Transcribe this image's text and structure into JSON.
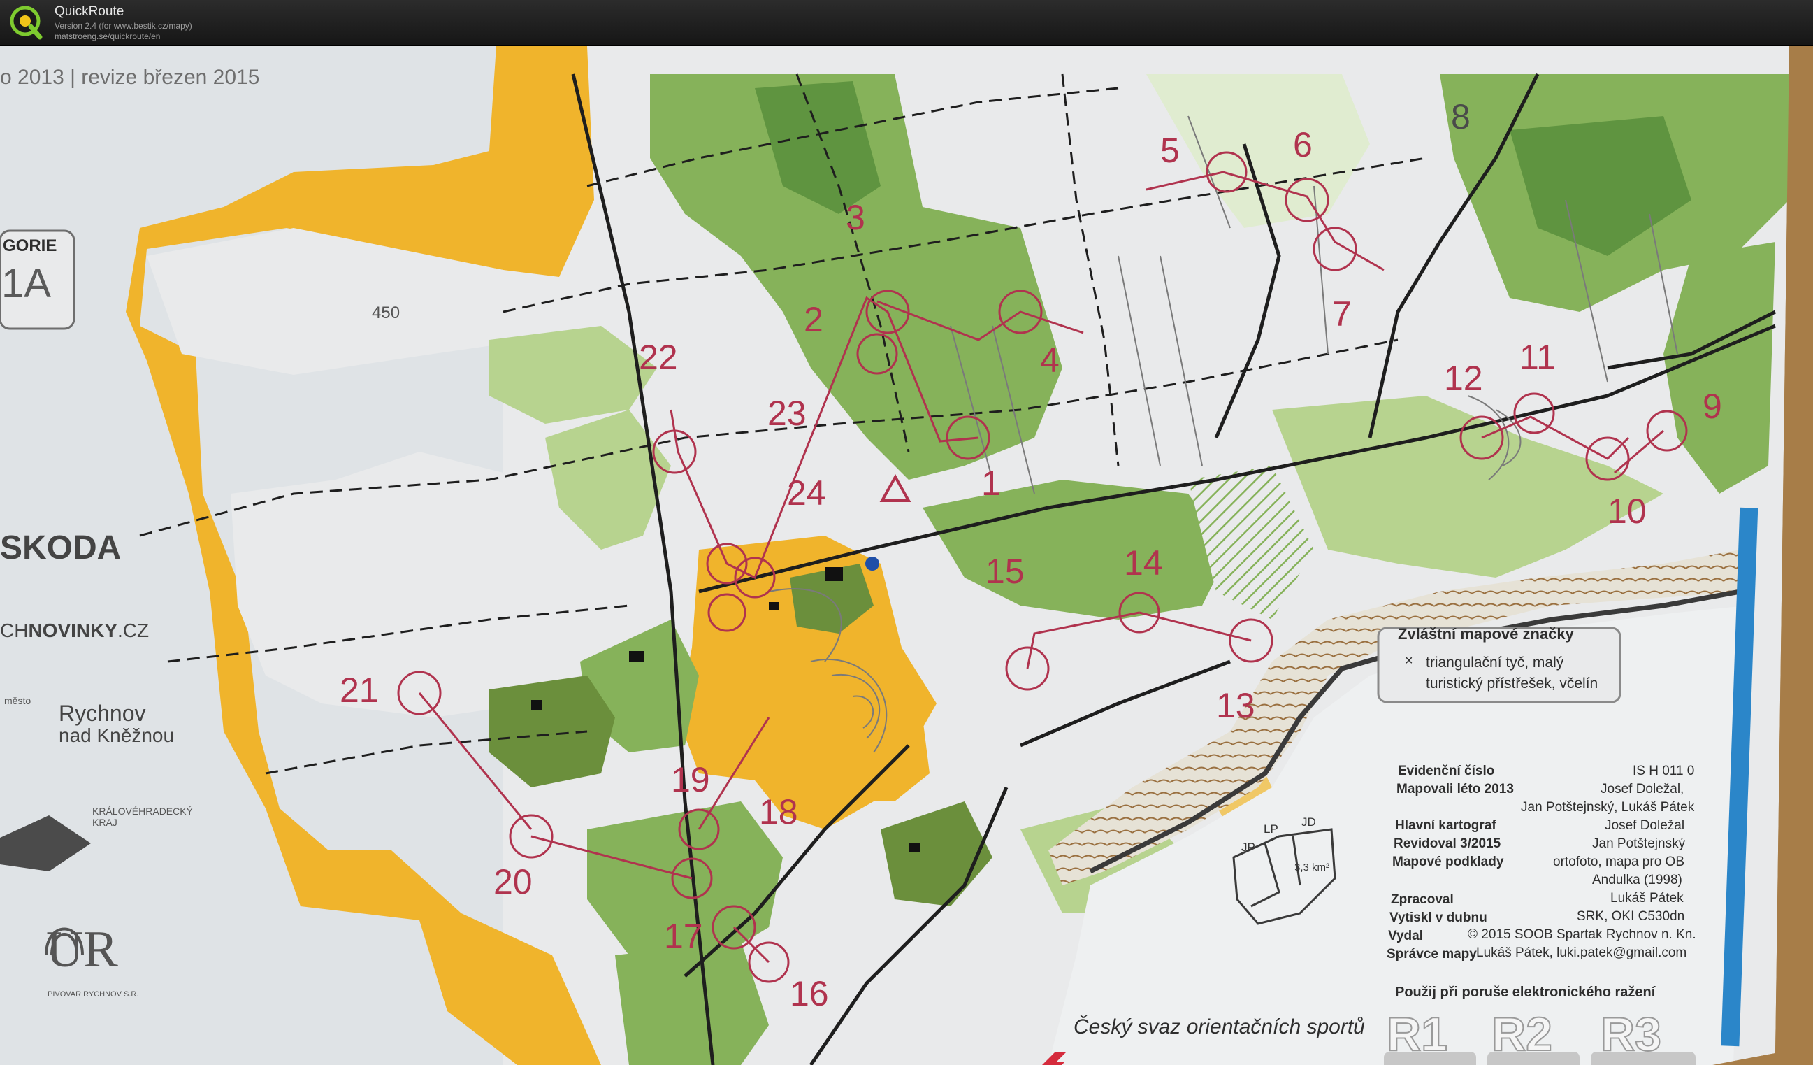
{
  "window": {
    "title": "QuickRoute",
    "version": "Version 2.4  (for www.bestik.cz/mapy)",
    "url": "matstroeng.se/quickroute/en",
    "logo_letter": "Q"
  },
  "map": {
    "header_partial": "o 2013 | revize březen 2015",
    "category_label": "GORIE",
    "category_value": "1A",
    "contour_height": "450",
    "sponsors": {
      "skoda": "SKODA",
      "novinky_prefix": "CH",
      "novinky_bold": "NOVINKY",
      "novinky_suffix": ".CZ",
      "rychnov_line1": "Rychnov",
      "rychnov_line2": "nad Kněžnou",
      "mesto": "město",
      "kraj_line1": "KRÁLOVÉHRADECKÝ",
      "kraj_line2": "KRAJ",
      "brewery_logo": "UR",
      "brewery_name": "PIVOVAR RYCHNOV S.R."
    },
    "controls": [
      "1",
      "2",
      "3",
      "4",
      "5",
      "6",
      "7",
      "8",
      "9",
      "10",
      "11",
      "12",
      "13",
      "14",
      "15",
      "16",
      "17",
      "18",
      "19",
      "20",
      "21",
      "22",
      "23",
      "24"
    ],
    "special_symbols": {
      "title": "Zvláštní mapové značky",
      "symbol": "×",
      "line1": "triangulační tyč, malý",
      "line2": "turistický přístřešek, včelín"
    },
    "map_info": {
      "evidence_label": "Evidenční číslo",
      "evidence_value": "IS H 011 0",
      "mapped_label": "Mapovali léto 2013",
      "mapped_value1": "Josef Doležal,",
      "mapped_value2": "Jan Potštejnský, Lukáš Pátek",
      "cartographer_label": "Hlavní kartograf",
      "cartographer_value": "Josef Doležal",
      "revised_label": "Revidoval 3/2015",
      "revised_value": "Jan Potštejnský",
      "base_label": "Mapové podklady",
      "base_value1": "ortofoto, mapa pro OB",
      "base_value2": "Andulka (1998)",
      "processed_label": "Zpracoval",
      "processed_value": "Lukáš Pátek",
      "printed_label": "Vytiskl v dubnu",
      "printed_value": "SRK, OKI C530dn",
      "published_label": "Vydal",
      "published_value": "© 2015 SOOB Spartak Rychnov n. Kn.",
      "admin_label": "Správce mapy",
      "admin_value": "Lukáš Pátek, luki.patek@gmail.com"
    },
    "area_labels": [
      "JD",
      "LP",
      "JP"
    ],
    "area_size": "3,3 km²",
    "failure_note": "Použij při poruše elektronického ražení",
    "backup_boxes": [
      "R1",
      "R2",
      "R3"
    ],
    "federation": "Český svaz orientačních sportů"
  },
  "colors": {
    "paper": "#e9eaeb",
    "forest": "#86b25a",
    "forest_dark": "#5f9440",
    "open_land": "#f0b42c",
    "course": "#b0334e",
    "blue_band": "#2b86c9",
    "table": "#b68d56"
  }
}
